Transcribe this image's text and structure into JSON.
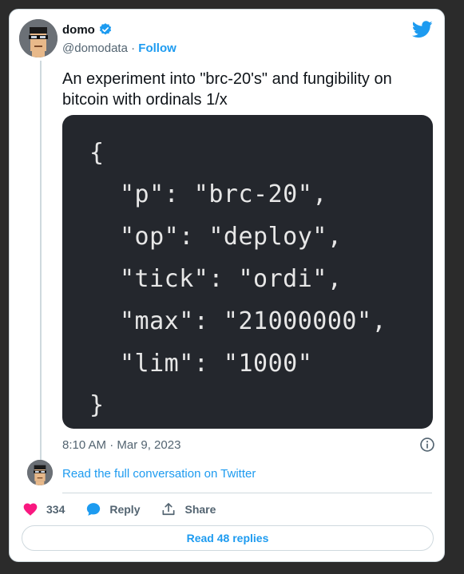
{
  "author": {
    "name": "domo",
    "handle": "@domodata",
    "separator": "·",
    "follow_label": "Follow"
  },
  "tweet": {
    "text_line1": "An experiment into \"brc-20's\" and fungibility on",
    "text_line2": "bitcoin with ordinals 1/x",
    "timestamp": "8:10 AM · Mar 9, 2023"
  },
  "code_image": {
    "lines": [
      "{",
      "\"p\": \"brc-20\",",
      "\"op\": \"deploy\",",
      "\"tick\": \"ordi\",",
      "\"max\": \"21000000\",",
      "\"lim\": \"1000\"",
      "}"
    ]
  },
  "conversation": {
    "link_label": "Read the full conversation on Twitter"
  },
  "actions": {
    "like_count": "334",
    "reply_label": "Reply",
    "share_label": "Share"
  },
  "footer": {
    "read_replies_label": "Read 48 replies"
  },
  "icons": [
    "verified-badge-icon",
    "twitter-bird-icon",
    "info-icon",
    "heart-icon",
    "reply-bubble-icon",
    "share-icon"
  ],
  "colors": {
    "accent": "#1d9bf0",
    "like": "#f91880",
    "code_bg": "#24272d",
    "secondary_text": "#536471"
  }
}
